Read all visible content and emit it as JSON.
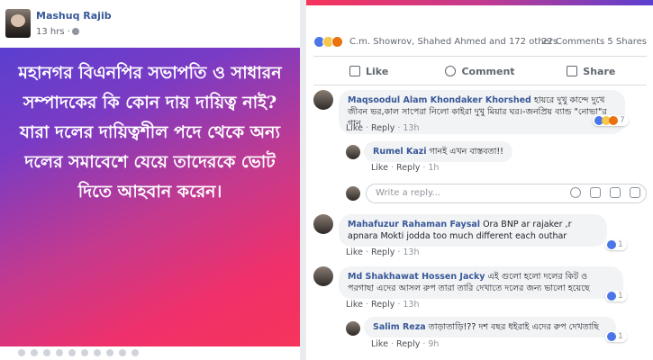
{
  "post": {
    "author": "Mashuq Rajib",
    "time": "13 hrs ·",
    "text": "মহানগর বিএনপির সভাপতি ও সাধারন সম্পাদকের কি কোন দায় দায়িত্ব নাই? যারা দলের দায়িত্বশীল পদে থেকে অন্য দলের সমাবেশে যেয়ে তাদেরকে ভোট দিতে আহবান করেন।"
  },
  "reactions": {
    "names": "C.m. Showrov, Shahed Ahmed and 172 others",
    "counts": "22 Comments   5 Shares"
  },
  "actions": {
    "like": "Like",
    "comment": "Comment",
    "share": "Share"
  },
  "comments": [
    {
      "name": "Maqsoodul Alam Khondaker Khorshed",
      "text": "হায়রে দুখু কান্দে দুখে জীবন ভর,কাল সাপেরা নিলো কাইরা দুখু মিয়ার ঘর।-জনপ্রিয় ব্যান্ড \"নোভা\"র গান",
      "like": "Like",
      "reply": "Reply",
      "time": "13h",
      "count": "7"
    },
    {
      "name": "Rumel Kazi",
      "text": "গানই এখন বাস্তবতা!!",
      "like": "Like",
      "reply": "Reply",
      "time": "1h"
    },
    {
      "name": "Mahafuzur Rahaman Faysal",
      "text": "Ora BNP ar rajaker ,r apnara Mokti jodda too much different each outhar",
      "like": "Like",
      "reply": "Reply",
      "time": "13h",
      "count": "1"
    },
    {
      "name": "Md Shakhawat Hossen Jacky",
      "text": "এই গুলো হলো দলের কিট ও পরগাছা এদের আসল রুপ তারা তারি দেখাতে দলের জন্য ভালো হয়েছে",
      "like": "Like",
      "reply": "Reply",
      "time": "13h",
      "count": "1"
    },
    {
      "name": "Salim Reza",
      "text": "তাড়াতাড়ি!?? দশ বছর ধইরাই এদের রুপ দেখতাছি",
      "like": "Like",
      "reply": "Reply",
      "time": "9h",
      "count": "1"
    }
  ],
  "reply_box": {
    "placeholder": "Write a reply..."
  }
}
